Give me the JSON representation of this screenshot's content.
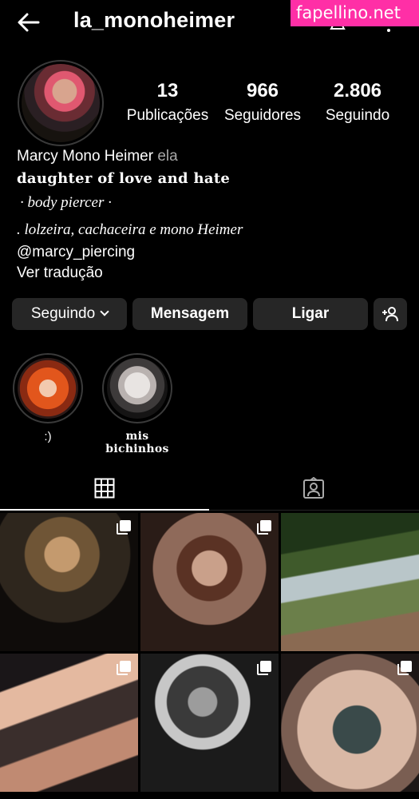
{
  "header": {
    "username": "la_monoheimer",
    "watermark": "fapellino.net"
  },
  "profile": {
    "stats": [
      {
        "value": "13",
        "label": "Publicações"
      },
      {
        "value": "966",
        "label": "Seguidores"
      },
      {
        "value": "2.806",
        "label": "Seguindo"
      }
    ],
    "name": "Marcy Mono Heimer",
    "pronoun": "ela",
    "bio_lines": [
      "daughter of love and hate",
      "· body piercer ·",
      ". lolzeira, cachaceira e mono Heimer"
    ],
    "mention": "@marcy_piercing",
    "translate": "Ver tradução"
  },
  "actions": {
    "following": "Seguindo",
    "message": "Mensagem",
    "call": "Ligar"
  },
  "highlights": [
    {
      "label": ":)"
    },
    {
      "label": "mis bichinhos"
    }
  ],
  "colors": {
    "background": "#000000",
    "button": "#262626",
    "watermark": "#ff2fa6"
  }
}
